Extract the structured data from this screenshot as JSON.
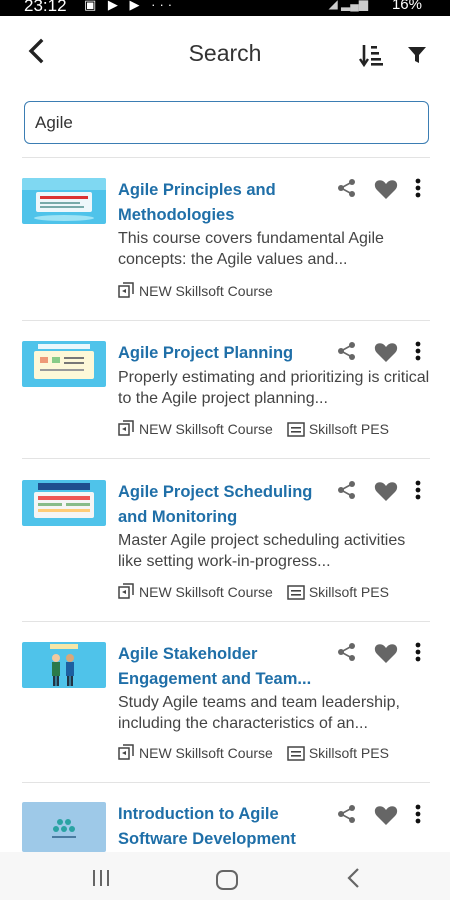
{
  "status_bar": {
    "time": "23:12",
    "notification_icons": "▣ ▶ ▶ ···",
    "battery": "16%"
  },
  "header": {
    "title": "Search",
    "back_icon": "chevron-left-icon",
    "sort_icon": "sort-icon",
    "filter_icon": "filter-icon"
  },
  "search": {
    "value": "Agile"
  },
  "colors": {
    "title_link": "#1f6fa8",
    "search_border": "#3b7db3",
    "icon_gray": "#666666"
  },
  "courses": [
    {
      "title": "Agile Principles and Methodologies",
      "description": "This course covers fundamental Agile concepts: the Agile values and...",
      "type": "NEW Skillsoft Course",
      "tag": ""
    },
    {
      "title": "Agile Project Planning",
      "description": "Properly estimating and prioritizing is critical to the Agile project planning...",
      "type": "NEW Skillsoft Course",
      "tag": "Skillsoft PES"
    },
    {
      "title": "Agile Project Scheduling and Monitoring",
      "description": "Master Agile project scheduling activities like setting work-in-progress...",
      "type": "NEW Skillsoft Course",
      "tag": "Skillsoft PES"
    },
    {
      "title": "Agile Stakeholder Engagement and Team...",
      "description": "Study Agile teams and team leadership, including the characteristics of an...",
      "type": "NEW Skillsoft Course",
      "tag": "Skillsoft PES"
    },
    {
      "title": "Introduction to Agile Software Development",
      "description": "",
      "type": "",
      "tag": ""
    }
  ]
}
